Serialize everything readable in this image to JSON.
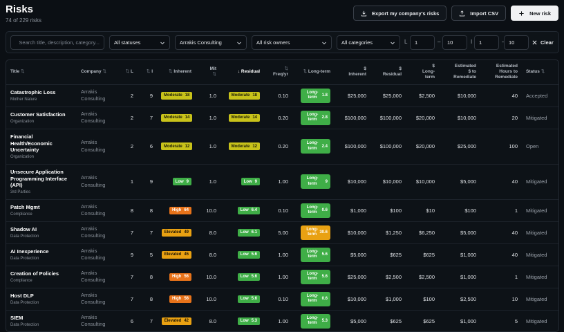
{
  "header": {
    "title": "Risks",
    "subtitle": "74 of 229 risks",
    "export_label": "Export my company's risks",
    "import_label": "Import CSV",
    "new_label": "New risk"
  },
  "filters": {
    "search_placeholder": "Search title, description, category...",
    "status": "All statuses",
    "company": "Arrakis Consulting",
    "owner": "All risk owners",
    "category": "All categories",
    "l_label": "L",
    "l_min": "1",
    "l_max": "10",
    "i_label": "I",
    "i_min": "1",
    "i_max": "10",
    "dash": "–",
    "clear_label": "Clear"
  },
  "columns": [
    {
      "label": "Title",
      "sort": "⇅"
    },
    {
      "label": "Company",
      "sort": "⇅"
    },
    {
      "label": "L",
      "sort": "⇅"
    },
    {
      "label": "I",
      "sort": "⇅"
    },
    {
      "label": "Inherent",
      "sort": "⇅"
    },
    {
      "label": "Mit",
      "label2": "⇅"
    },
    {
      "label": "Residual",
      "sort": "↓"
    },
    {
      "label": "Freq/yr",
      "sort": "⇅"
    },
    {
      "label": "Long-term",
      "sort": "⇅"
    },
    {
      "label": "$",
      "label2": "Inherent"
    },
    {
      "label": "$",
      "label2": "Residual"
    },
    {
      "label": "$",
      "label2": "Long-",
      "label3": "term"
    },
    {
      "label": "Estimated",
      "label2": "$ to",
      "label3": "Remediate"
    },
    {
      "label": "Estimated",
      "label2": "Hours to",
      "label3": "Remediate"
    },
    {
      "label": "Status",
      "sort": "⇅"
    }
  ],
  "colors": {
    "moderate": "#c8c21a",
    "low": "#3fae47",
    "high": "#e8731a",
    "elevated": "#e9a112",
    "lt_green": "#3fae47",
    "lt_orange": "#e9a112"
  },
  "rows": [
    {
      "title": "Catastrophic Loss",
      "category": "Mother Nature",
      "company": [
        "Arrakis",
        "Consulting"
      ],
      "l": "2",
      "i": "9",
      "inherent": {
        "level": "moderate",
        "text": "Moderate",
        "score": "18"
      },
      "mit": "1.0",
      "residual": {
        "level": "moderate",
        "text": "Moderate",
        "score": "18"
      },
      "freq": "0.10",
      "lt": {
        "level": "lt_green",
        "score": "1.8"
      },
      "d_inh": "$25,000",
      "d_res": "$25,000",
      "d_lt": "$2,500",
      "d_rem": "$10,000",
      "hours": "40",
      "status": "Accepted",
      "tall": false
    },
    {
      "title": "Customer Satisfaction",
      "category": "Organization",
      "company": [
        "Arrakis",
        "Consulting"
      ],
      "l": "2",
      "i": "7",
      "inherent": {
        "level": "moderate",
        "text": "Moderate",
        "score": "14"
      },
      "mit": "1.0",
      "residual": {
        "level": "moderate",
        "text": "Moderate",
        "score": "14"
      },
      "freq": "0.20",
      "lt": {
        "level": "lt_green",
        "score": "2.8"
      },
      "d_inh": "$100,000",
      "d_res": "$100,000",
      "d_lt": "$20,000",
      "d_rem": "$10,000",
      "hours": "20",
      "status": "Mitigated",
      "tall": false
    },
    {
      "title": "Financial Health/Economic Uncertainty",
      "category": "Organization",
      "company": [
        "Arrakis",
        "Consulting"
      ],
      "l": "2",
      "i": "6",
      "inherent": {
        "level": "moderate",
        "text": "Moderate",
        "score": "12"
      },
      "mit": "1.0",
      "residual": {
        "level": "moderate",
        "text": "Moderate",
        "score": "12"
      },
      "freq": "0.20",
      "lt": {
        "level": "lt_green",
        "score": "2.4"
      },
      "d_inh": "$100,000",
      "d_res": "$100,000",
      "d_lt": "$20,000",
      "d_rem": "$25,000",
      "hours": "100",
      "status": "Open",
      "tall": true
    },
    {
      "title": "Unsecure Application Programming Interface (API)",
      "category": "3rd Parties",
      "company": [
        "Arrakis",
        "Consulting"
      ],
      "l": "1",
      "i": "9",
      "inherent": {
        "level": "low",
        "text": "Low",
        "score": "9"
      },
      "mit": "1.0",
      "residual": {
        "level": "low",
        "text": "Low",
        "score": "9"
      },
      "freq": "1.00",
      "lt": {
        "level": "lt_green",
        "score": "9"
      },
      "d_inh": "$10,000",
      "d_res": "$10,000",
      "d_lt": "$10,000",
      "d_rem": "$5,000",
      "hours": "40",
      "status": "Mitigated",
      "tall": true
    },
    {
      "title": "Patch Mgmt",
      "category": "Compliance",
      "company": [
        "Arrakis",
        "Consulting"
      ],
      "l": "8",
      "i": "8",
      "inherent": {
        "level": "high",
        "text": "High",
        "score": "64"
      },
      "mit": "10.0",
      "residual": {
        "level": "low",
        "text": "Low",
        "score": "6.4"
      },
      "freq": "0.10",
      "lt": {
        "level": "lt_green",
        "score": "0.6"
      },
      "d_inh": "$1,000",
      "d_res": "$100",
      "d_lt": "$10",
      "d_rem": "$100",
      "hours": "1",
      "status": "Mitigated",
      "tall": false
    },
    {
      "title": "Shadow AI",
      "category": "Data Protection",
      "company": [
        "Arrakis",
        "Consulting"
      ],
      "l": "7",
      "i": "7",
      "inherent": {
        "level": "elevated",
        "text": "Elevated",
        "score": "49"
      },
      "mit": "8.0",
      "residual": {
        "level": "low",
        "text": "Low",
        "score": "6.1"
      },
      "freq": "5.00",
      "lt": {
        "level": "lt_orange",
        "score": "30.6"
      },
      "d_inh": "$10,000",
      "d_res": "$1,250",
      "d_lt": "$6,250",
      "d_rem": "$5,000",
      "hours": "40",
      "status": "Mitigated",
      "tall": false
    },
    {
      "title": "AI Inexperience",
      "category": "Data Protection",
      "company": [
        "Arrakis",
        "Consulting"
      ],
      "l": "9",
      "i": "5",
      "inherent": {
        "level": "elevated",
        "text": "Elevated",
        "score": "45"
      },
      "mit": "8.0",
      "residual": {
        "level": "low",
        "text": "Low",
        "score": "5.6"
      },
      "freq": "1.00",
      "lt": {
        "level": "lt_green",
        "score": "5.6"
      },
      "d_inh": "$5,000",
      "d_res": "$625",
      "d_lt": "$625",
      "d_rem": "$1,000",
      "hours": "40",
      "status": "Mitigated",
      "tall": false
    },
    {
      "title": "Creation of Policies",
      "category": "Compliance",
      "company": [
        "Arrakis",
        "Consulting"
      ],
      "l": "7",
      "i": "8",
      "inherent": {
        "level": "high",
        "text": "High",
        "score": "56"
      },
      "mit": "10.0",
      "residual": {
        "level": "low",
        "text": "Low",
        "score": "5.6"
      },
      "freq": "1.00",
      "lt": {
        "level": "lt_green",
        "score": "5.6"
      },
      "d_inh": "$25,000",
      "d_res": "$2,500",
      "d_lt": "$2,500",
      "d_rem": "$1,000",
      "hours": "1",
      "status": "Mitigated",
      "tall": false
    },
    {
      "title": "Host DLP",
      "category": "Data Protection",
      "company": [
        "Arrakis",
        "Consulting"
      ],
      "l": "7",
      "i": "8",
      "inherent": {
        "level": "high",
        "text": "High",
        "score": "56"
      },
      "mit": "10.0",
      "residual": {
        "level": "low",
        "text": "Low",
        "score": "5.6"
      },
      "freq": "0.10",
      "lt": {
        "level": "lt_green",
        "score": "0.6"
      },
      "d_inh": "$10,000",
      "d_res": "$1,000",
      "d_lt": "$100",
      "d_rem": "$2,500",
      "hours": "10",
      "status": "Mitigated",
      "tall": false
    },
    {
      "title": "SIEM",
      "category": "Data Protection",
      "company": [
        "Arrakis",
        "Consulting"
      ],
      "l": "6",
      "i": "7",
      "inherent": {
        "level": "elevated",
        "text": "Elevated",
        "score": "42"
      },
      "mit": "8.0",
      "residual": {
        "level": "low",
        "text": "Low",
        "score": "5.3"
      },
      "freq": "1.00",
      "lt": {
        "level": "lt_green",
        "score": "5.3"
      },
      "d_inh": "$5,000",
      "d_res": "$625",
      "d_lt": "$625",
      "d_rem": "$1,000",
      "hours": "5",
      "status": "Mitigated",
      "tall": false
    }
  ]
}
